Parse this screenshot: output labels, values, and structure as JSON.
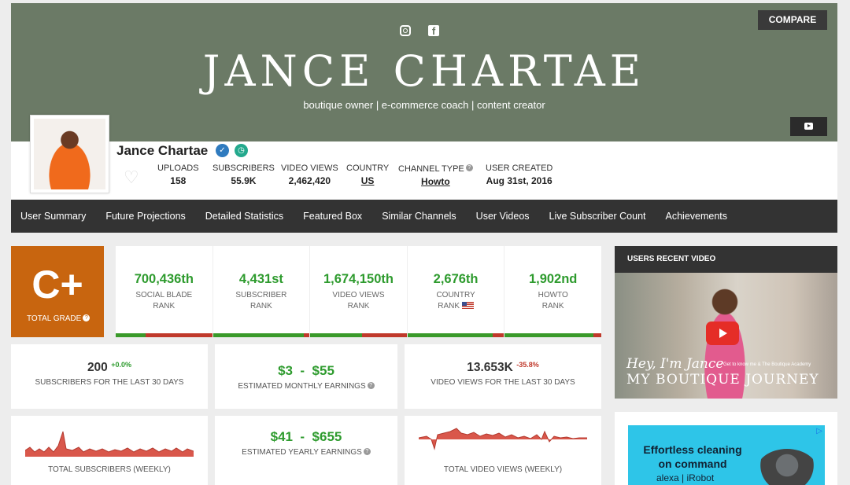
{
  "banner": {
    "title": "JANCE CHARTAE",
    "tagline": "boutique owner | e-commerce coach | content creator",
    "compare_label": "COMPARE"
  },
  "profile": {
    "name": "Jance Chartae",
    "stats": [
      {
        "label": "UPLOADS",
        "value": "158"
      },
      {
        "label": "SUBSCRIBERS",
        "value": "55.9K"
      },
      {
        "label": "VIDEO VIEWS",
        "value": "2,462,420"
      },
      {
        "label": "COUNTRY",
        "value": "US"
      },
      {
        "label": "CHANNEL TYPE",
        "value": "Howto"
      },
      {
        "label": "USER CREATED",
        "value": "Aug 31st, 2016"
      }
    ]
  },
  "nav": {
    "items": [
      "User Summary",
      "Future Projections",
      "Detailed Statistics",
      "Featured Box",
      "Similar Channels",
      "User Videos",
      "Live Subscriber Count",
      "Achievements"
    ]
  },
  "grade": {
    "value": "C+",
    "label": "TOTAL GRADE"
  },
  "ranks": [
    {
      "value": "700,436th",
      "label1": "SOCIAL BLADE",
      "label2": "RANK",
      "fill": 0.31
    },
    {
      "value": "4,431st",
      "label1": "SUBSCRIBER",
      "label2": "RANK",
      "fill": 0.94
    },
    {
      "value": "1,674,150th",
      "label1": "VIDEO VIEWS",
      "label2": "RANK",
      "fill": 0.54
    },
    {
      "value": "2,676th",
      "label1": "COUNTRY",
      "label2": "RANK",
      "fill": 0.88
    },
    {
      "value": "1,902nd",
      "label1": "HOWTO",
      "label2": "RANK",
      "fill": 0.92
    }
  ],
  "cards": {
    "subs30": {
      "value": "200",
      "delta": "+0.0%",
      "label": "SUBSCRIBERS FOR THE LAST 30 DAYS"
    },
    "monthly": {
      "value": "$3  -  $55",
      "label": "ESTIMATED MONTHLY EARNINGS"
    },
    "views30": {
      "value": "13.653K",
      "delta": "-35.8%",
      "label": "VIDEO VIEWS FOR THE LAST 30 DAYS"
    },
    "yearly": {
      "value": "$41  -  $655",
      "label": "ESTIMATED YEARLY EARNINGS"
    },
    "subs_weekly": {
      "label": "TOTAL SUBSCRIBERS (WEEKLY)"
    },
    "views_weekly": {
      "label": "TOTAL VIDEO VIEWS (WEEKLY)"
    }
  },
  "recent_video": {
    "heading": "USERS RECENT VIDEO",
    "line1": "Hey, I'm Jance",
    "line2": "MY BOUTIQUE JOURNEY",
    "line3": "Get to know me & The Boutique Academy"
  },
  "ad": {
    "headline": "Effortless cleaning on command",
    "brand": "alexa | iRobot"
  },
  "colors": {
    "banner": "#6b7a66",
    "grade": "#c8650f",
    "rank_green": "#2e9b2e",
    "bar_red": "#c0392b",
    "nav": "#333333"
  }
}
